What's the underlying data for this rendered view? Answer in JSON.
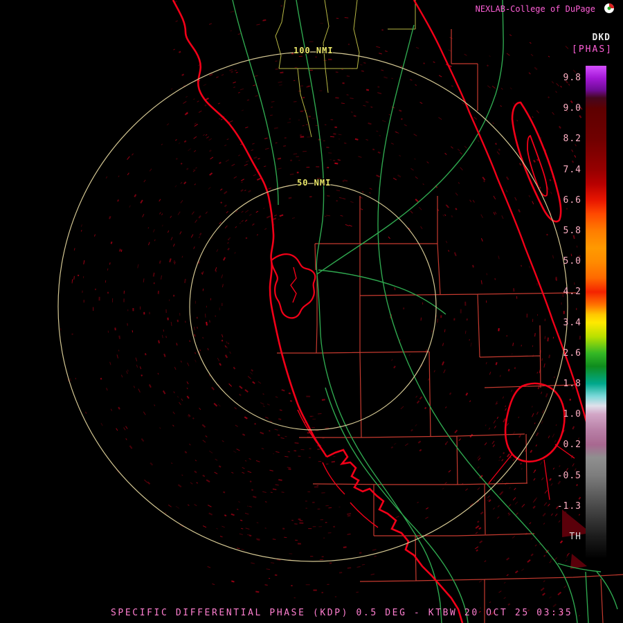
{
  "header": {
    "title": "NEXLAB-College of DuPage"
  },
  "product": {
    "id": "DKD",
    "units": "[PHAS]"
  },
  "caption": "SPECIFIC DIFFERENTIAL PHASE (KDP) 0.5 DEG - KTBW 20 OCT 25 03:35",
  "range_rings": {
    "outer": "100 NMI",
    "inner": "50 NMI"
  },
  "scale": {
    "labels": [
      "9.8",
      "9.0",
      "8.2",
      "7.4",
      "6.6",
      "5.8",
      "5.0",
      "4.2",
      "3.4",
      "2.6",
      "1.8",
      "1.0",
      "0.2",
      "-0.5",
      "-1.3",
      "TH"
    ],
    "gradient": [
      {
        "pos": 0,
        "color": "#d44fff"
      },
      {
        "pos": 2.5,
        "color": "#a318d6"
      },
      {
        "pos": 5,
        "color": "#6e0b94"
      },
      {
        "pos": 6.5,
        "color": "#45071f"
      },
      {
        "pos": 8.7,
        "color": "#5e0000"
      },
      {
        "pos": 14.9,
        "color": "#700000"
      },
      {
        "pos": 21.1,
        "color": "#960000"
      },
      {
        "pos": 24,
        "color": "#b80000"
      },
      {
        "pos": 27.3,
        "color": "#e81600"
      },
      {
        "pos": 30,
        "color": "#ff4800"
      },
      {
        "pos": 33.5,
        "color": "#ff7d00"
      },
      {
        "pos": 37,
        "color": "#ff9900"
      },
      {
        "pos": 39.7,
        "color": "#ff8c00"
      },
      {
        "pos": 43,
        "color": "#ff6a00"
      },
      {
        "pos": 45.9,
        "color": "#f42300"
      },
      {
        "pos": 48.5,
        "color": "#ff7300"
      },
      {
        "pos": 50.5,
        "color": "#ffc800"
      },
      {
        "pos": 52.1,
        "color": "#ffe900"
      },
      {
        "pos": 55,
        "color": "#b8e000"
      },
      {
        "pos": 58.3,
        "color": "#35b825"
      },
      {
        "pos": 61,
        "color": "#0f8c1e"
      },
      {
        "pos": 64.5,
        "color": "#00a88c"
      },
      {
        "pos": 67,
        "color": "#79d8d8"
      },
      {
        "pos": 69,
        "color": "#e0e0ea"
      },
      {
        "pos": 70.7,
        "color": "#d2a6c6"
      },
      {
        "pos": 74,
        "color": "#b87fa6"
      },
      {
        "pos": 76.9,
        "color": "#a86890"
      },
      {
        "pos": 79.5,
        "color": "#8f8f8f"
      },
      {
        "pos": 83.1,
        "color": "#7d7d7d"
      },
      {
        "pos": 89.3,
        "color": "#4a4a4a"
      },
      {
        "pos": 95.5,
        "color": "#1c1c1c"
      },
      {
        "pos": 100,
        "color": "#000000"
      }
    ]
  },
  "colors": {
    "background": "#000000",
    "coastline": "#f20018",
    "county_lines": "#c63a2f",
    "county_lines_alt": "#b9b945",
    "highways": "#2fa84f",
    "range_rings": "#d6c994",
    "ring_label_text": "#ece96a",
    "header_text": "#ff5fd7",
    "caption_text": "#ff7fd0",
    "scale_text": "#ffb0c4",
    "product_id_text": "#eaeaea",
    "speckle": "#8f0012"
  }
}
